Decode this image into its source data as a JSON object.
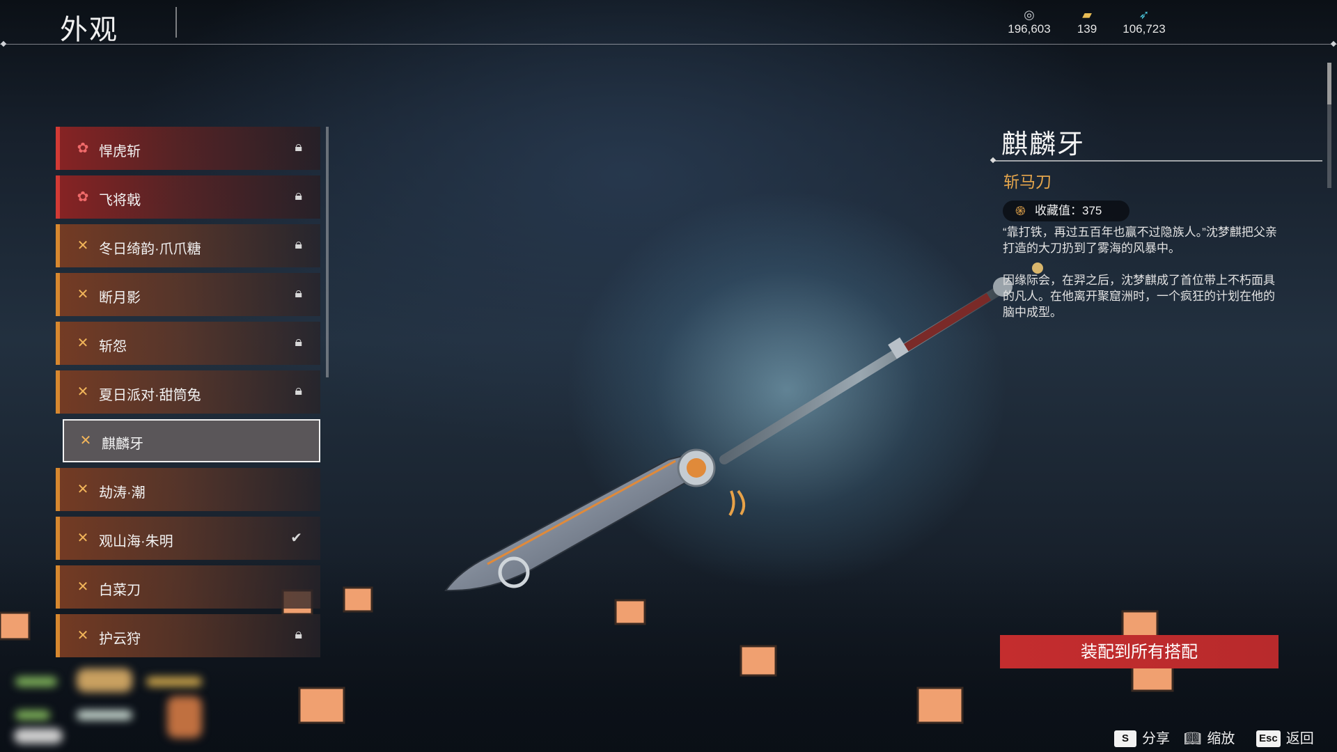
{
  "header": {
    "title": "外观",
    "currencies": [
      {
        "icon": "silver-coin-icon",
        "value": "196,603"
      },
      {
        "icon": "gold-ticket-icon",
        "value": "139"
      },
      {
        "icon": "blue-feather-icon",
        "value": "106,723"
      }
    ]
  },
  "appearance_list": {
    "items": [
      {
        "name": "悍虎斩",
        "rarity": "red",
        "status": "locked"
      },
      {
        "name": "飞将戟",
        "rarity": "red",
        "status": "locked"
      },
      {
        "name": "冬日绮韵·爪爪糖",
        "rarity": "gold",
        "status": "locked"
      },
      {
        "name": "断月影",
        "rarity": "gold",
        "status": "locked"
      },
      {
        "name": "斩怨",
        "rarity": "gold",
        "status": "locked"
      },
      {
        "name": "夏日派对·甜筒兔",
        "rarity": "gold",
        "status": "locked"
      },
      {
        "name": "麒麟牙",
        "rarity": "gold",
        "status": "selected"
      },
      {
        "name": "劫涛·潮",
        "rarity": "gold",
        "status": "none"
      },
      {
        "name": "观山海·朱明",
        "rarity": "gold",
        "status": "equipped"
      },
      {
        "name": "白菜刀",
        "rarity": "gold",
        "status": "none"
      },
      {
        "name": "护云狩",
        "rarity": "gold",
        "status": "locked"
      }
    ]
  },
  "detail": {
    "name": "麒麟牙",
    "type": "斩马刀",
    "collection_label": "收藏值：375",
    "desc_1": "“靠打铁，再过五百年也赢不过隐族人。”沈梦麒把父亲打造的大刀扔到了雾海的风暴中。",
    "desc_2": "因缘际会，在羿之后，沈梦麒成了首位带上不朽面具的凡人。在他离开聚窟洲时，一个疯狂的计划在他的脑中成型。",
    "equip_button": "装配到所有搭配"
  },
  "hints": [
    {
      "key": "S",
      "label": "分享"
    },
    {
      "key": "",
      "icon": "book-icon",
      "label": "缩放"
    },
    {
      "key": "Esc",
      "label": "返回"
    }
  ],
  "colors": {
    "accent_gold": "#e6a64c",
    "accent_red": "#c42d2e"
  }
}
